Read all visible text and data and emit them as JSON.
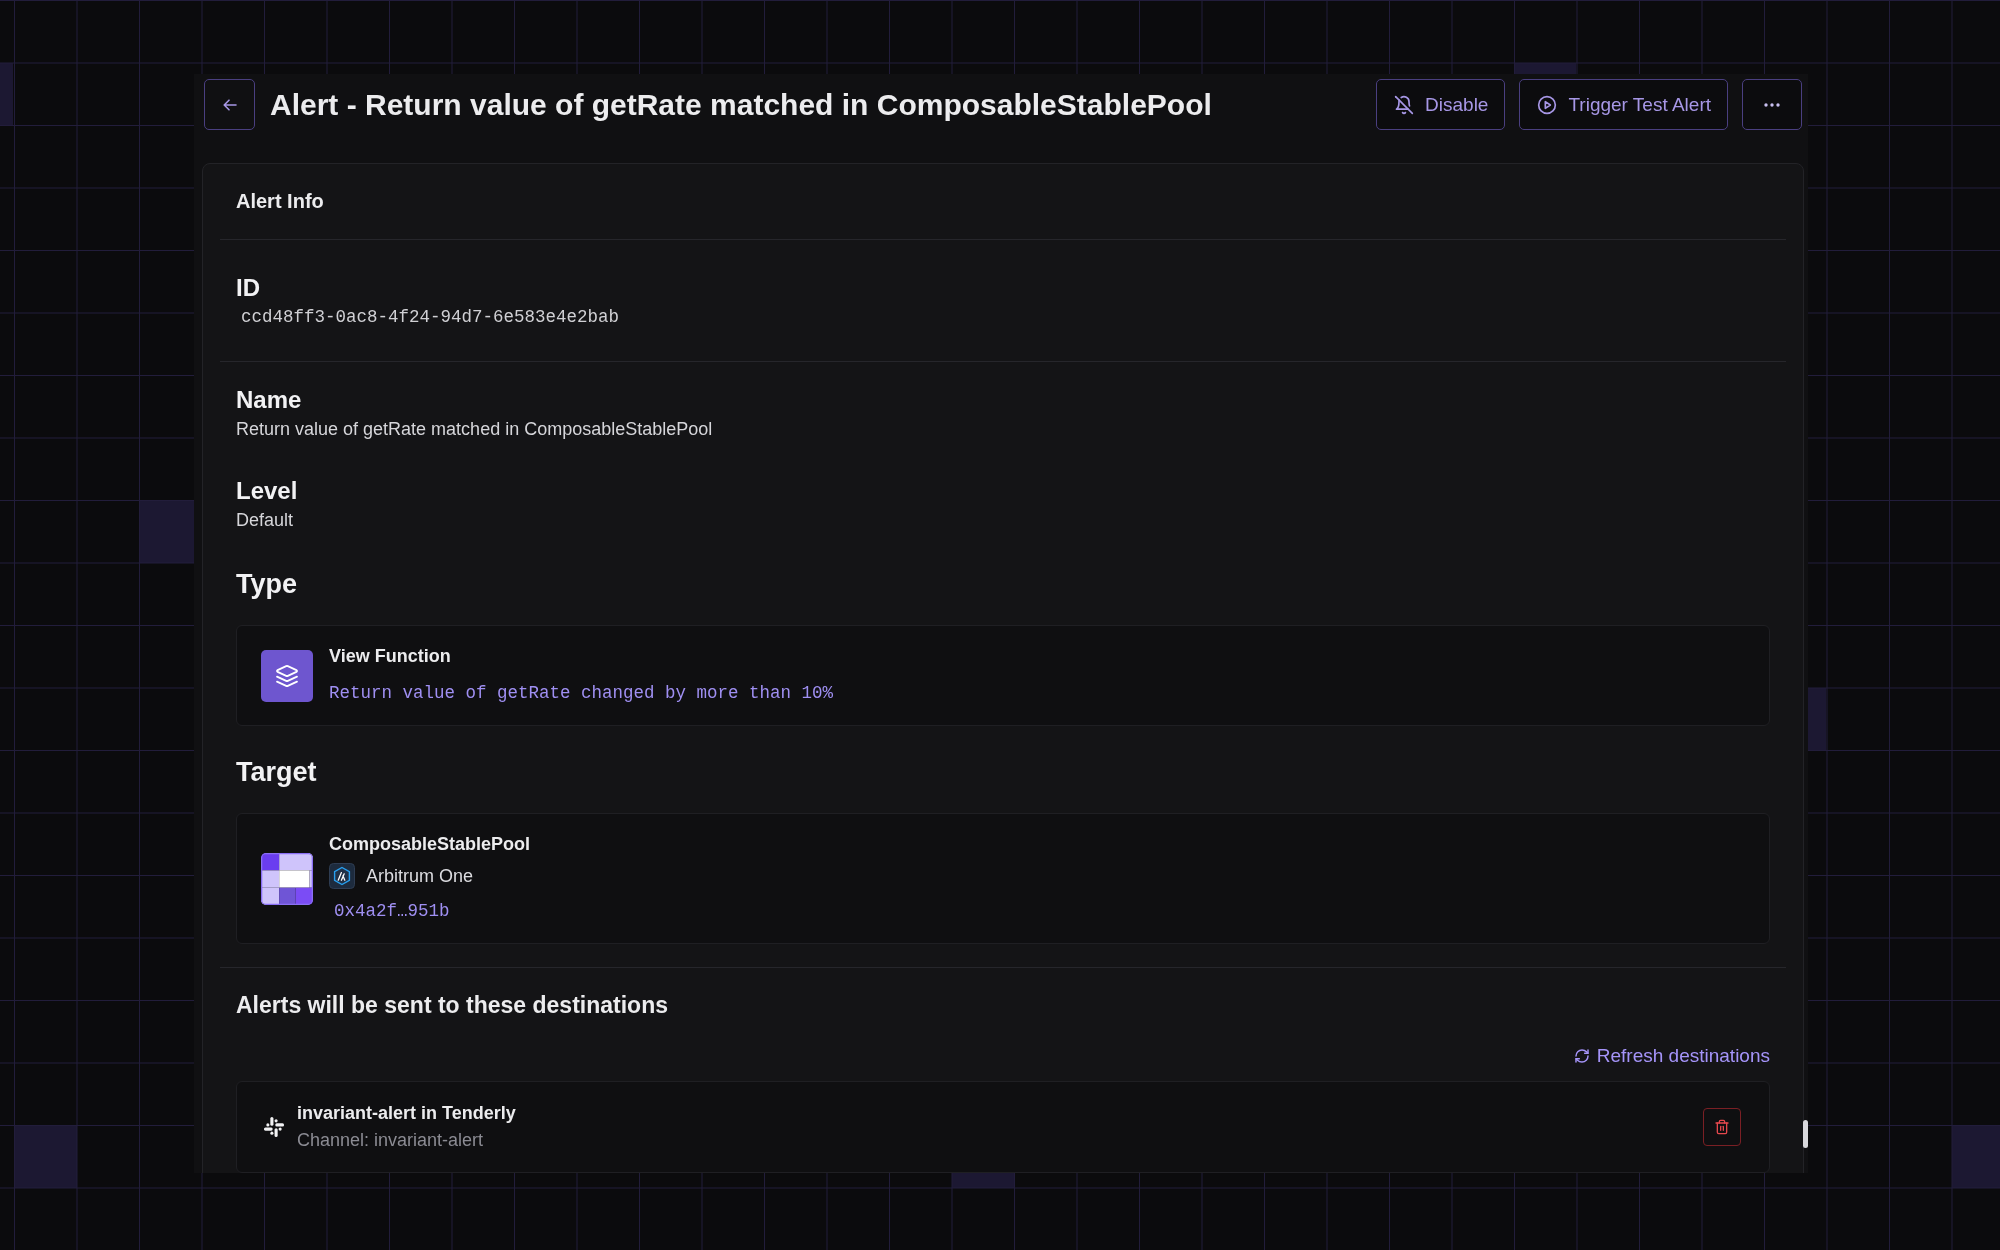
{
  "title": "Alert - Return value of getRate matched in ComposableStablePool",
  "actions": [
    {
      "kind": "disable",
      "label": "Disable"
    },
    {
      "kind": "trigger",
      "label": "Trigger Test Alert"
    },
    {
      "kind": "more"
    }
  ],
  "alert_info": {
    "title": "Alert Info",
    "id": {
      "label": "ID",
      "value": "ccd48ff3-0ac8-4f24-94d7-6e583e4e2bab"
    },
    "fields": [
      {
        "label": "Name",
        "value": "Return value of getRate matched in ComposableStablePool"
      },
      {
        "label": "Level",
        "value": "Default"
      }
    ],
    "type": {
      "heading": "Type",
      "name": "View Function",
      "description": "Return value of getRate changed by more than 10%"
    },
    "target": {
      "heading": "Target",
      "name": "ComposableStablePool",
      "network": "Arbitrum One",
      "address": "0x4a2f…951b"
    }
  },
  "destinations": {
    "heading": "Alerts will be sent to these destinations",
    "refresh": "Refresh destinations",
    "items": [
      {
        "name": "invariant-alert in Tenderly",
        "channel": "Channel: invariant-alert"
      }
    ]
  }
}
